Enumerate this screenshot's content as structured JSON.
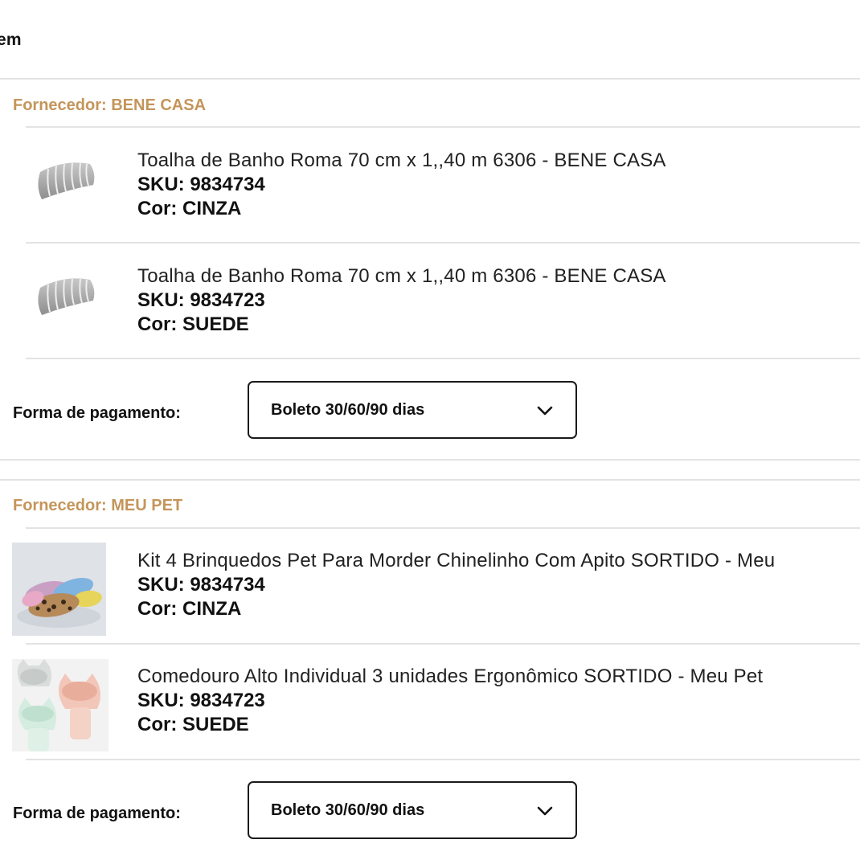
{
  "page": {
    "heading": "em"
  },
  "groups": [
    {
      "supplier": "Fornecedor: BENE CASA",
      "items": [
        {
          "title": "Toalha de Banho Roma 70 cm x 1,,40 m 6306 - BENE CASA",
          "sku": "SKU: 9834734",
          "color": "Cor: CINZA",
          "icon": "towel-image"
        },
        {
          "title": "Toalha de Banho Roma 70 cm x 1,,40 m 6306 - BENE CASA",
          "sku": "SKU: 9834723",
          "color": "Cor: SUEDE",
          "icon": "towel-image"
        }
      ],
      "payment": {
        "label": "Forma de pagamento:",
        "selected": "Boleto 30/60/90 dias"
      }
    },
    {
      "supplier": "Fornecedor: MEU PET",
      "items": [
        {
          "title": "Kit 4 Brinquedos Pet Para Morder Chinelinho Com Apito SORTIDO - Meu",
          "sku": "SKU: 9834734",
          "color": "Cor: CINZA",
          "icon": "pet-toys-image"
        },
        {
          "title": "Comedouro Alto Individual 3 unidades Ergonômico SORTIDO - Meu Pet",
          "sku": "SKU: 9834723",
          "color": "Cor: SUEDE",
          "icon": "pet-bowls-image"
        }
      ],
      "payment": {
        "label": "Forma de pagamento:",
        "selected": "Boleto 30/60/90 dias"
      }
    }
  ],
  "colors": {
    "supplier": "#c4955a",
    "divider": "#e3e3e3",
    "text": "#111111"
  }
}
